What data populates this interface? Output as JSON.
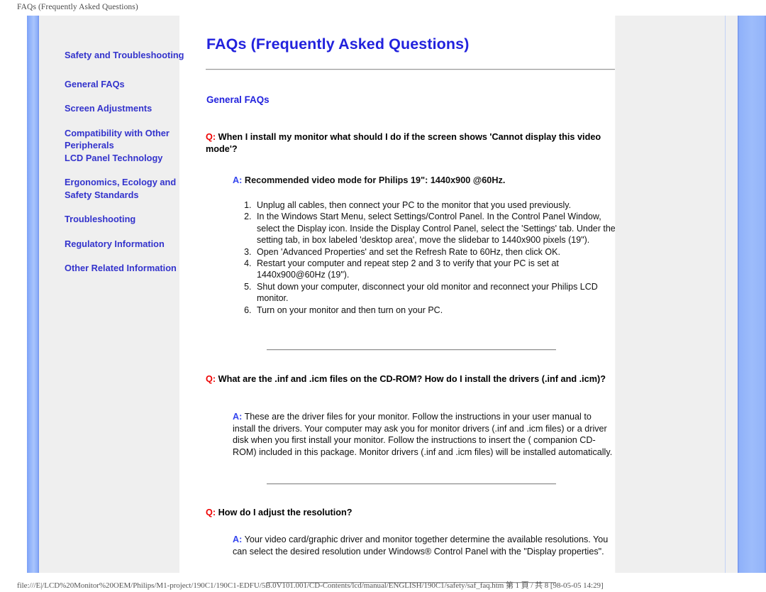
{
  "browser": {
    "page_header": "FAQs (Frequently Asked Questions)",
    "page_footer": "file:///E|/LCD%20Monitor%20OEM/Philips/M1-project/190C1/190C1-EDFU/5B.0V101.001/CD-Contents/lcd/manual/ENGLISH/190C1/safety/saf_faq.htm 第 1 頁 / 共 8 [98-05-05 14:29]"
  },
  "colors": {
    "link_blue": "#3333CC",
    "heading_blue": "#2222DD",
    "question_red": "#EE0000",
    "answer_blue": "#3344EE",
    "sidebar_bg": "#EFEFEF",
    "rail_blue": "#8FB1FA"
  },
  "sidebar": {
    "items": [
      {
        "label": "Safety and Troubleshooting"
      },
      {
        "label": "General FAQs"
      },
      {
        "label": "Screen Adjustments"
      },
      {
        "label": "Compatibility with Other Peripherals"
      },
      {
        "label": "LCD Panel Technology"
      },
      {
        "label": "Ergonomics, Ecology and Safety Standards"
      },
      {
        "label": "Troubleshooting"
      },
      {
        "label": "Regulatory Information"
      },
      {
        "label": "Other Related Information"
      }
    ]
  },
  "main": {
    "title": "FAQs (Frequently Asked Questions)",
    "section_heading": "General FAQs",
    "q_marker": "Q:",
    "a_marker": "A:",
    "faqs": [
      {
        "question": "When I install my monitor what should I do if the screen shows 'Cannot display this video mode'?",
        "answer_bold": "Recommended video mode for Philips 19\": 1440x900 @60Hz.",
        "steps": [
          "Unplug all cables, then connect your PC to the monitor that you used previously.",
          "In the Windows Start Menu, select Settings/Control Panel. In the Control Panel Window, select the Display icon. Inside the Display Control Panel, select the 'Settings' tab. Under the setting tab, in box labeled 'desktop area', move the slidebar to 1440x900 pixels (19\").",
          "Open 'Advanced Properties' and set the Refresh Rate to 60Hz, then click OK.",
          "Restart your computer and repeat step 2 and 3 to verify that your PC is set at 1440x900@60Hz (19\").",
          "Shut down your computer, disconnect your old monitor and reconnect your Philips LCD monitor.",
          "Turn on your monitor and then turn on your PC."
        ]
      },
      {
        "question": "What are the .inf and .icm files on the CD-ROM? How do I install the drivers (.inf and .icm)?",
        "answer": "These are the driver files for your monitor. Follow the instructions in your user manual to install the drivers. Your computer may ask you for monitor drivers (.inf and .icm files) or a driver disk when you first install your monitor. Follow the instructions to insert the ( companion CD-ROM) included in this package. Monitor drivers (.inf and .icm files) will be installed automatically."
      },
      {
        "question": "How do I adjust the resolution?",
        "answer": "Your video card/graphic driver and monitor together determine the available resolutions. You can select the desired resolution under Windows® Control Panel with the \"Display properties\"."
      }
    ]
  }
}
